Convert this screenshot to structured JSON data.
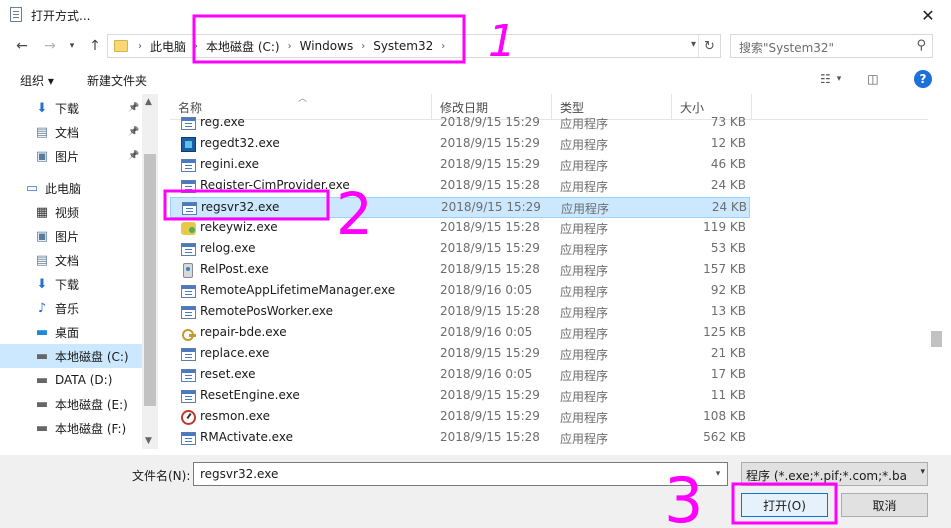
{
  "window": {
    "title": "打开方式..."
  },
  "address": {
    "crumbs": [
      "此电脑",
      "本地磁盘 (C:)",
      "Windows",
      "System32"
    ]
  },
  "search": {
    "placeholder": "搜索\"System32\""
  },
  "toolbar": {
    "organize_label": "组织 ▾",
    "new_folder_label": "新建文件夹"
  },
  "sidebar": {
    "items": [
      {
        "label": "下载",
        "icon": "download-icon",
        "pinned": true
      },
      {
        "label": "文档",
        "icon": "document-icon",
        "pinned": true
      },
      {
        "label": "图片",
        "icon": "picture-icon",
        "pinned": true
      },
      {
        "label": "此电脑",
        "icon": "computer-icon"
      },
      {
        "label": "视频",
        "icon": "video-icon"
      },
      {
        "label": "图片",
        "icon": "picture-icon"
      },
      {
        "label": "文档",
        "icon": "document-icon"
      },
      {
        "label": "下载",
        "icon": "download-icon"
      },
      {
        "label": "音乐",
        "icon": "music-icon"
      },
      {
        "label": "桌面",
        "icon": "desktop-icon"
      },
      {
        "label": "本地磁盘 (C:)",
        "icon": "drive-icon",
        "selected": true
      },
      {
        "label": "DATA (D:)",
        "icon": "drive-icon"
      },
      {
        "label": "本地磁盘 (E:)",
        "icon": "drive-icon"
      },
      {
        "label": "本地磁盘 (F:)",
        "icon": "drive-icon"
      }
    ]
  },
  "files": {
    "columns": [
      "名称",
      "修改日期",
      "类型",
      "大小"
    ],
    "rows": [
      {
        "name": "reg.exe",
        "date": "2018/9/15 15:29",
        "type": "应用程序",
        "size": "73 KB",
        "icon": "exe"
      },
      {
        "name": "regedt32.exe",
        "date": "2018/9/15 15:29",
        "type": "应用程序",
        "size": "12 KB",
        "icon": "regedit"
      },
      {
        "name": "regini.exe",
        "date": "2018/9/15 15:29",
        "type": "应用程序",
        "size": "46 KB",
        "icon": "exe"
      },
      {
        "name": "Register-CimProvider.exe",
        "date": "2018/9/15 15:28",
        "type": "应用程序",
        "size": "24 KB",
        "icon": "exe"
      },
      {
        "name": "regsvr32.exe",
        "date": "2018/9/15 15:29",
        "type": "应用程序",
        "size": "24 KB",
        "icon": "exe",
        "selected": true
      },
      {
        "name": "rekeywiz.exe",
        "date": "2018/9/15 15:28",
        "type": "应用程序",
        "size": "119 KB",
        "icon": "wiz"
      },
      {
        "name": "relog.exe",
        "date": "2018/9/15 15:29",
        "type": "应用程序",
        "size": "53 KB",
        "icon": "exe"
      },
      {
        "name": "RelPost.exe",
        "date": "2018/9/15 15:28",
        "type": "应用程序",
        "size": "157 KB",
        "icon": "relpost"
      },
      {
        "name": "RemoteAppLifetimeManager.exe",
        "date": "2018/9/16 0:05",
        "type": "应用程序",
        "size": "92 KB",
        "icon": "exe"
      },
      {
        "name": "RemotePosWorker.exe",
        "date": "2018/9/15 15:28",
        "type": "应用程序",
        "size": "13 KB",
        "icon": "exe"
      },
      {
        "name": "repair-bde.exe",
        "date": "2018/9/16 0:05",
        "type": "应用程序",
        "size": "125 KB",
        "icon": "bde"
      },
      {
        "name": "replace.exe",
        "date": "2018/9/15 15:29",
        "type": "应用程序",
        "size": "21 KB",
        "icon": "exe"
      },
      {
        "name": "reset.exe",
        "date": "2018/9/16 0:05",
        "type": "应用程序",
        "size": "17 KB",
        "icon": "exe"
      },
      {
        "name": "ResetEngine.exe",
        "date": "2018/9/15 15:29",
        "type": "应用程序",
        "size": "11 KB",
        "icon": "exe"
      },
      {
        "name": "resmon.exe",
        "date": "2018/9/15 15:29",
        "type": "应用程序",
        "size": "108 KB",
        "icon": "resmon"
      },
      {
        "name": "RMActivate.exe",
        "date": "2018/9/15 15:28",
        "type": "应用程序",
        "size": "562 KB",
        "icon": "exe"
      }
    ]
  },
  "bottom": {
    "filename_label": "文件名(N):",
    "filename_value": "regsvr32.exe",
    "filetype_value": "程序 (*.exe;*.pif;*.com;*.bat;*.cmd)",
    "open_label": "打开(O)",
    "cancel_label": "取消"
  },
  "annotations": {
    "step1": "1",
    "step2": "2",
    "step3": "3",
    "color": "#ff00ff"
  }
}
